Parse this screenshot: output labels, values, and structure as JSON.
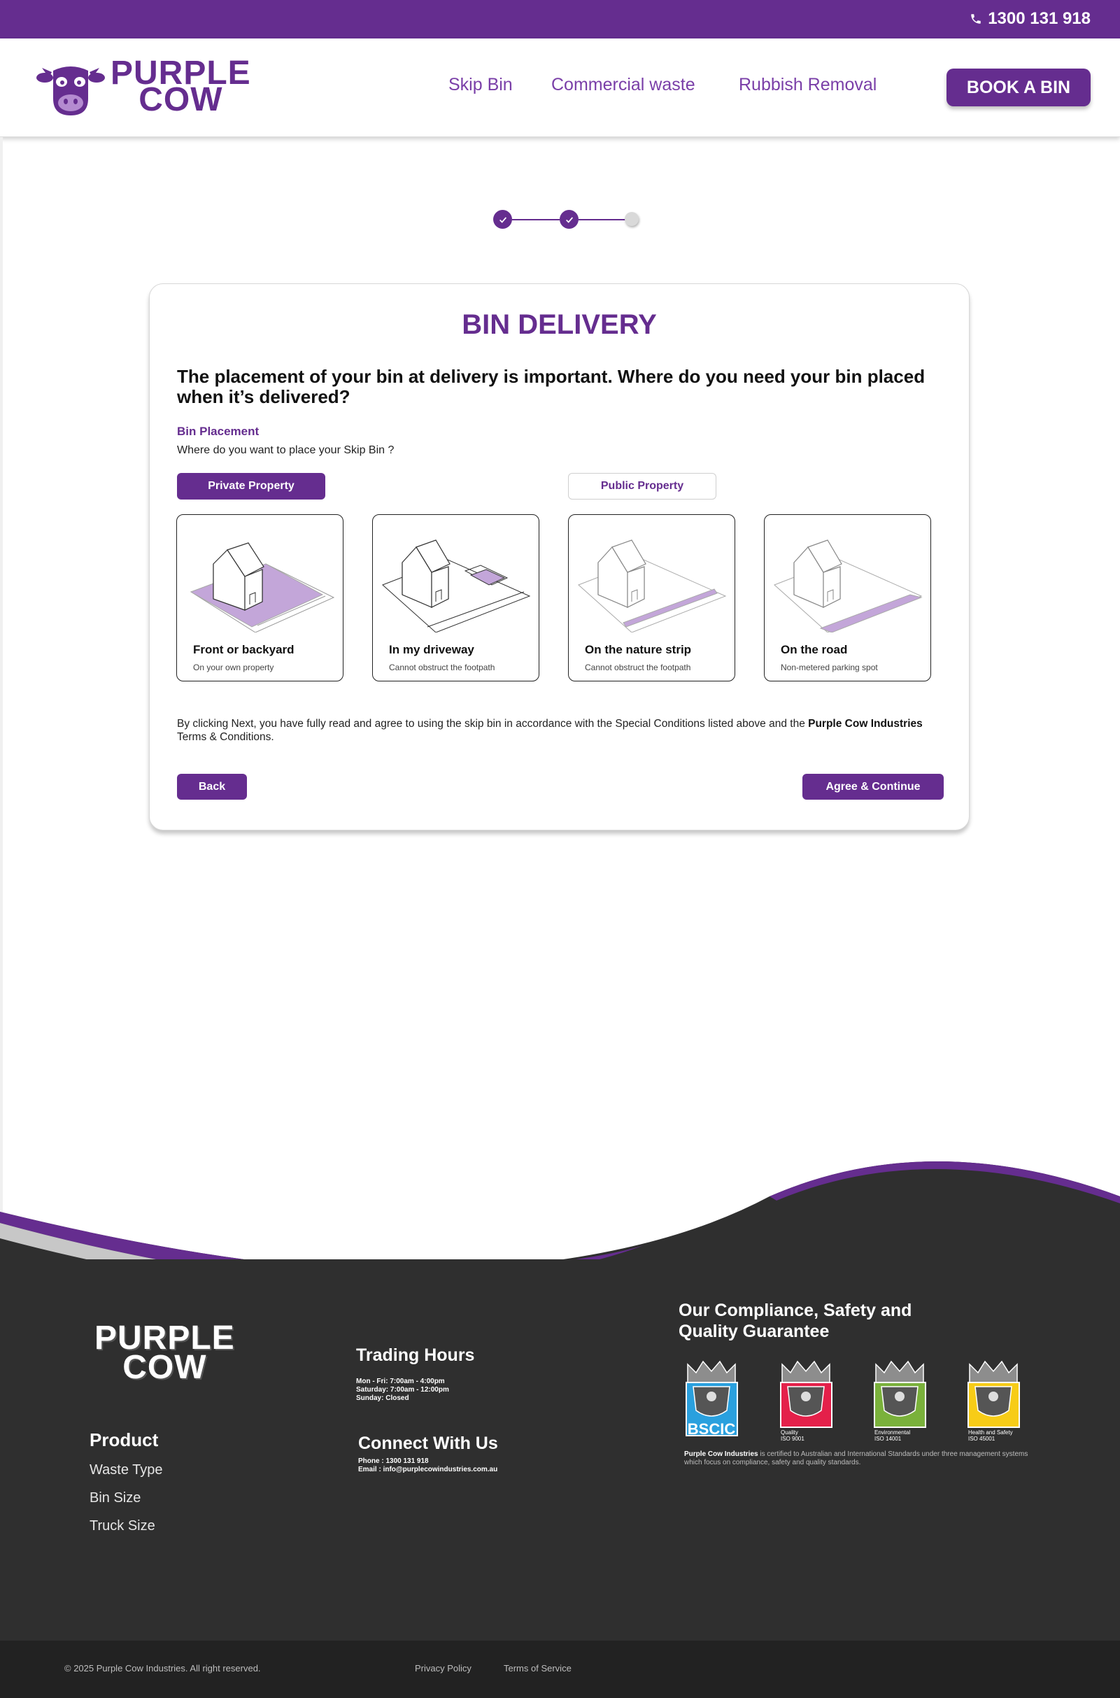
{
  "topbar": {
    "phone": "1300 131 918",
    "phone_icon": "phone-icon"
  },
  "header": {
    "logo_line1": "PURPLE",
    "logo_line2": "COW",
    "nav": [
      "Skip Bin",
      "Commercial waste",
      "Rubbish Removal"
    ],
    "cta": "BOOK A BIN"
  },
  "stepper": {
    "steps": [
      "complete",
      "complete",
      "current"
    ]
  },
  "card": {
    "title": "BIN DELIVERY",
    "question": "The placement of your bin at delivery is important. Where do you need your bin placed when it’s delivered?",
    "placement_label": "Bin Placement",
    "placement_sub": "Where do you want to place your Skip Bin ?",
    "toggle_private": "Private Property",
    "toggle_public": "Public Property",
    "options": [
      {
        "title": "Front or backyard",
        "sub": "On your own property",
        "icon": "house-yard-icon"
      },
      {
        "title": "In my driveway",
        "sub": "Cannot obstruct the footpath",
        "icon": "house-driveway-icon"
      },
      {
        "title": "On the nature strip",
        "sub": "Cannot obstruct the footpath",
        "icon": "house-nature-strip-icon"
      },
      {
        "title": "On the road",
        "sub": "Non-metered parking spot",
        "icon": "house-road-icon"
      }
    ],
    "terms_pre": "By clicking Next, you have fully read and agree to using the skip bin in accordance with the Special Conditions listed above and the ",
    "terms_bold": "Purple Cow Industries",
    "terms_post": " Terms & Conditions.",
    "back": "Back",
    "continue": "Agree & Continue"
  },
  "footer": {
    "logo_line1": "PURPLE",
    "logo_line2": "COW",
    "product_title": "Product",
    "product_links": [
      "Waste Type",
      "Bin Size",
      "Truck Size"
    ],
    "hours_title": "Trading Hours",
    "hours": [
      "Mon - Fri: 7:00am - 4:00pm",
      "Saturday: 7:00am - 12:00pm",
      "Sunday: Closed"
    ],
    "connect_title": "Connect With Us",
    "connect": [
      "Phone : 1300 131 918",
      "Email : info@purplecowindustries.com.au"
    ],
    "compliance_title": "Our Compliance, Safety and Quality Guarantee",
    "badges": [
      {
        "label": "BSCIC",
        "color": "#2aa0de"
      },
      {
        "label": "Quality ISO 9001",
        "color": "#e4204a"
      },
      {
        "label": "Environmental ISO 14001",
        "color": "#7ab13b"
      },
      {
        "label": "Health and Safety ISO 45001",
        "color": "#f7cc17"
      }
    ],
    "cert_bold": "Purple Cow Industries",
    "cert_text": " is certified to Australian and International Standards under three management systems which focus on compliance, safety and quality standards."
  },
  "bottom": {
    "copyright": "© 2025 Purple Cow Industries. All right reserved.",
    "privacy": "Privacy Policy",
    "tos": "Terms of Service"
  },
  "colors": {
    "brand": "#652d8f",
    "footer_bg": "#2f2f2f",
    "highlight": "#c3a6d9"
  }
}
